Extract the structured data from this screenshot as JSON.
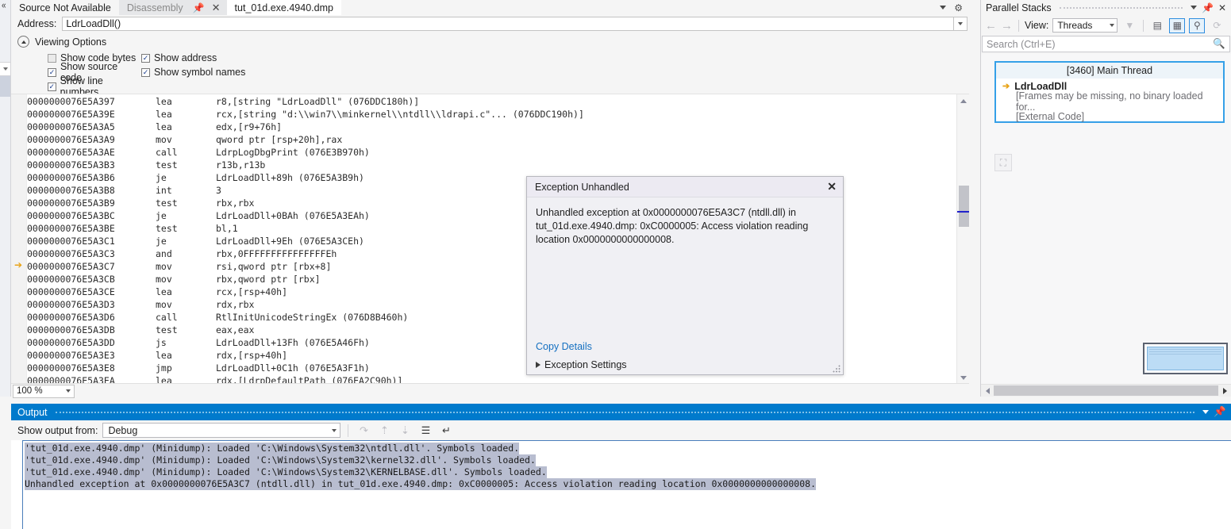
{
  "tabs": {
    "source_not_available": "Source Not Available",
    "disassembly": "Disassembly",
    "dump_file": "tut_01d.exe.4940.dmp",
    "pin_icon": "pin-icon",
    "close_icon": "close-icon",
    "dropdown_icon": "chevron-down-icon",
    "settings_icon": "gear-icon"
  },
  "address_bar": {
    "label": "Address:",
    "value": "LdrLoadDll()",
    "dropdown_icon": "chevron-down-icon"
  },
  "viewing_options": {
    "title": "Viewing Options",
    "collapse_icon": "chevron-up-icon",
    "checkboxes": [
      {
        "label": "Show code bytes",
        "checked": false
      },
      {
        "label": "Show address",
        "checked": true
      },
      {
        "label": "Show source code",
        "checked": true
      },
      {
        "label": "Show symbol names",
        "checked": true
      },
      {
        "label": "Show line numbers",
        "checked": true
      }
    ]
  },
  "disassembly": {
    "current_instruction_index": 13,
    "lines": [
      {
        "address": "0000000076E5A397",
        "op": "lea",
        "args": "r8,[string \"LdrLoadDll\" (076DDC180h)]"
      },
      {
        "address": "0000000076E5A39E",
        "op": "lea",
        "args": "rcx,[string \"d:\\\\win7\\\\minkernel\\\\ntdll\\\\ldrapi.c\"... (076DDC190h)]"
      },
      {
        "address": "0000000076E5A3A5",
        "op": "lea",
        "args": "edx,[r9+76h]"
      },
      {
        "address": "0000000076E5A3A9",
        "op": "mov",
        "args": "qword ptr [rsp+20h],rax"
      },
      {
        "address": "0000000076E5A3AE",
        "op": "call",
        "args": "LdrpLogDbgPrint (076E3B970h)"
      },
      {
        "address": "0000000076E5A3B3",
        "op": "test",
        "args": "r13b,r13b"
      },
      {
        "address": "0000000076E5A3B6",
        "op": "je",
        "args": "LdrLoadDll+89h (076E5A3B9h)"
      },
      {
        "address": "0000000076E5A3B8",
        "op": "int",
        "args": "3"
      },
      {
        "address": "0000000076E5A3B9",
        "op": "test",
        "args": "rbx,rbx"
      },
      {
        "address": "0000000076E5A3BC",
        "op": "je",
        "args": "LdrLoadDll+0BAh (076E5A3EAh)"
      },
      {
        "address": "0000000076E5A3BE",
        "op": "test",
        "args": "bl,1"
      },
      {
        "address": "0000000076E5A3C1",
        "op": "je",
        "args": "LdrLoadDll+9Eh (076E5A3CEh)"
      },
      {
        "address": "0000000076E5A3C3",
        "op": "and",
        "args": "rbx,0FFFFFFFFFFFFFFFEh"
      },
      {
        "address": "0000000076E5A3C7",
        "op": "mov",
        "args": "rsi,qword ptr [rbx+8]"
      },
      {
        "address": "0000000076E5A3CB",
        "op": "mov",
        "args": "rbx,qword ptr [rbx]"
      },
      {
        "address": "0000000076E5A3CE",
        "op": "lea",
        "args": "rcx,[rsp+40h]"
      },
      {
        "address": "0000000076E5A3D3",
        "op": "mov",
        "args": "rdx,rbx"
      },
      {
        "address": "0000000076E5A3D6",
        "op": "call",
        "args": "RtlInitUnicodeStringEx (076D8B460h)"
      },
      {
        "address": "0000000076E5A3DB",
        "op": "test",
        "args": "eax,eax"
      },
      {
        "address": "0000000076E5A3DD",
        "op": "js",
        "args": "LdrLoadDll+13Fh (076E5A46Fh)"
      },
      {
        "address": "0000000076E5A3E3",
        "op": "lea",
        "args": "rdx,[rsp+40h]"
      },
      {
        "address": "0000000076E5A3E8",
        "op": "jmp",
        "args": "LdrLoadDll+0C1h (076E5A3F1h)"
      },
      {
        "address": "0000000076E5A3EA",
        "op": "lea",
        "args": "rdx,[LdrpDefaultPath (076EA2C90h)]"
      }
    ]
  },
  "zoom_control": {
    "value": "100 %",
    "dropdown_icon": "chevron-down-icon"
  },
  "exception_dialog": {
    "title": "Exception Unhandled",
    "close_icon": "close-icon",
    "message": "Unhandled exception at 0x0000000076E5A3C7 (ntdll.dll) in tut_01d.exe.4940.dmp: 0xC0000005: Access violation reading location 0x0000000000000008.",
    "copy_details_link": "Copy Details",
    "exception_settings_label": "Exception Settings",
    "expander_icon": "triangle-right-icon",
    "link_color": "#1570c1"
  },
  "parallel_stacks": {
    "title": "Parallel Stacks",
    "pin_icon": "pin-icon",
    "close_icon": "close-icon",
    "back_icon": "arrow-left-icon",
    "forward_icon": "arrow-right-icon",
    "view_label": "View:",
    "view_value": "Threads",
    "view_dropdown_icon": "chevron-down-icon",
    "filter_icon": "funnel-icon",
    "toggle_method_view_icon": "method-view-icon",
    "auto_scroll_icon": "auto-scroll-icon",
    "zoom_to_thread_icon": "zoom-to-thread-icon",
    "refresh_icon": "refresh-icon",
    "fit_icon": "fit-to-window-icon",
    "search_placeholder": "Search (Ctrl+E)",
    "search_icon": "search-icon",
    "accent_color": "#35a0e8",
    "thread_box": {
      "header": "[3460] Main Thread",
      "frames": [
        {
          "label": "LdrLoadDll",
          "current": true,
          "arrow_icon": "current-frame-arrow-icon"
        },
        {
          "label": "[Frames may be missing, no binary loaded for...",
          "current": false
        },
        {
          "label": "[External Code]",
          "current": false
        }
      ]
    },
    "hscroll_left_icon": "arrow-left-icon",
    "hscroll_right_icon": "arrow-right-icon"
  },
  "output": {
    "title": "Output",
    "dropdown_icon": "chevron-down-icon",
    "pin_icon": "pin-icon",
    "show_output_from_label": "Show output from:",
    "source_value": "Debug",
    "source_dropdown_icon": "chevron-down-icon",
    "toolbar_icons": [
      "find-message-icon",
      "go-to-previous-icon",
      "go-to-next-icon",
      "clear-all-icon",
      "toggle-word-wrap-icon"
    ],
    "lines": [
      "'tut_01d.exe.4940.dmp' (Minidump): Loaded 'C:\\Windows\\System32\\ntdll.dll'. Symbols loaded.",
      "'tut_01d.exe.4940.dmp' (Minidump): Loaded 'C:\\Windows\\System32\\kernel32.dll'. Symbols loaded.",
      "'tut_01d.exe.4940.dmp' (Minidump): Loaded 'C:\\Windows\\System32\\KERNELBASE.dll'. Symbols loaded.",
      "Unhandled exception at 0x0000000076E5A3C7 (ntdll.dll) in tut_01d.exe.4940.dmp: 0xC0000005: Access violation reading location 0x0000000000000008."
    ],
    "title_bar_color": "#007acc"
  }
}
